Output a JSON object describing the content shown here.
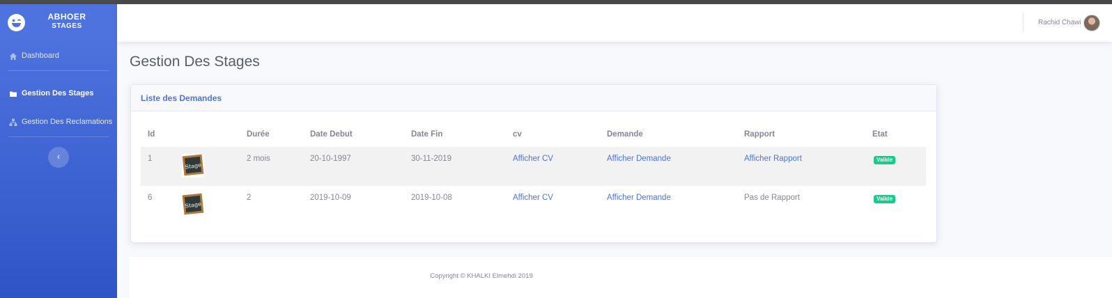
{
  "sidebar": {
    "brand_line1": "ABHOER",
    "brand_line2": "STAGES",
    "items": [
      {
        "label": "Dashboard",
        "icon": "home-icon"
      },
      {
        "label": "Gestion Des Stages",
        "icon": "folder-icon",
        "active": true
      },
      {
        "label": "Gestion Des Reclamations",
        "icon": "sitemap-icon"
      }
    ],
    "toggle_icon": "chevron-left-icon"
  },
  "topbar": {
    "user_name": "Rachid Chawi"
  },
  "page_title": "Gestion Des Stages",
  "card": {
    "title": "Liste des Demandes",
    "columns": [
      "Id",
      "",
      "Durée",
      "Date Debut",
      "Date Fin",
      "cv",
      "Demande",
      "Rapport",
      "Etat"
    ],
    "rows": [
      {
        "id": "1",
        "thumb_text": "Stage",
        "duree": "2 mois",
        "date_debut": "20-10-1997",
        "date_fin": "30-11-2019",
        "cv": "Afficher CV",
        "demande": "Afficher Demande",
        "rapport": "Afficher Rapport",
        "rapport_is_link": true,
        "etat": "Valide"
      },
      {
        "id": "6",
        "thumb_text": "Stage",
        "duree": "2",
        "date_debut": "2019-10-09",
        "date_fin": "2019-10-08",
        "cv": "Afficher CV",
        "demande": "Afficher Demande",
        "rapport": "Pas de Rapport",
        "rapport_is_link": false,
        "etat": "Valide"
      }
    ]
  },
  "footer": {
    "copyright": "Copyright © KHALKI Elmehdi 2019"
  },
  "colors": {
    "primary": "#4e73df",
    "success": "#1cc88a",
    "text_muted": "#858796",
    "heading": "#5a5c69"
  }
}
